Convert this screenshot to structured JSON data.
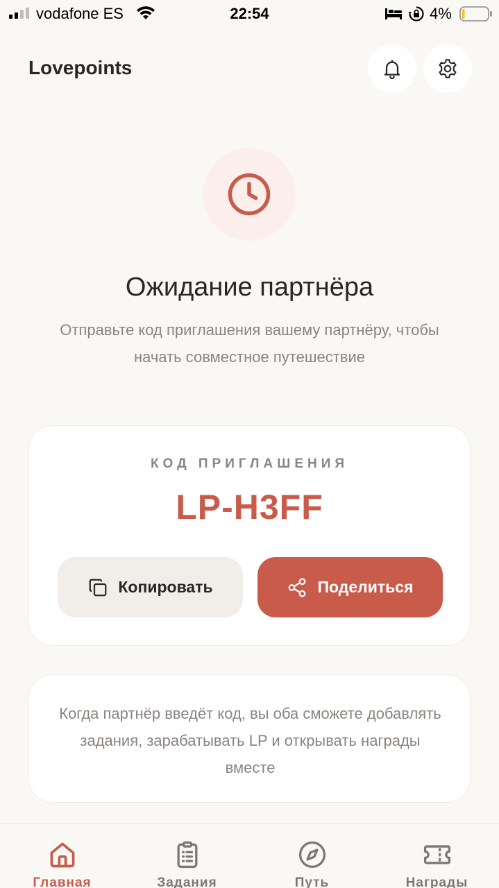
{
  "status_bar": {
    "carrier": "vodafone ES",
    "time": "22:54",
    "battery": "4%"
  },
  "header": {
    "title": "Lovepoints",
    "icons": [
      "bell-icon",
      "gear-icon"
    ]
  },
  "waiting": {
    "icon": "clock-icon",
    "title": "Ожидание партнёра",
    "subtitle": "Отправьте код приглашения вашему партнёру, чтобы начать совместное путешествие"
  },
  "invite": {
    "label": "КОД ПРИГЛАШЕНИЯ",
    "code": "LP-H3FF",
    "copy_label": "Копировать",
    "share_label": "Поделиться"
  },
  "info": {
    "text": "Когда партнёр введёт код, вы оба сможете добавлять задания, зарабатывать LP и открывать награды вместе"
  },
  "nav": {
    "items": [
      {
        "label": "Главная",
        "icon": "home-icon",
        "active": true
      },
      {
        "label": "Задания",
        "icon": "clipboard-icon",
        "active": false
      },
      {
        "label": "Путь",
        "icon": "compass-icon",
        "active": false
      },
      {
        "label": "Награды",
        "icon": "ticket-icon",
        "active": false
      }
    ]
  },
  "colors": {
    "accent": "#c95b4b",
    "background": "#faf8f5",
    "muted_text": "#8a8480"
  }
}
